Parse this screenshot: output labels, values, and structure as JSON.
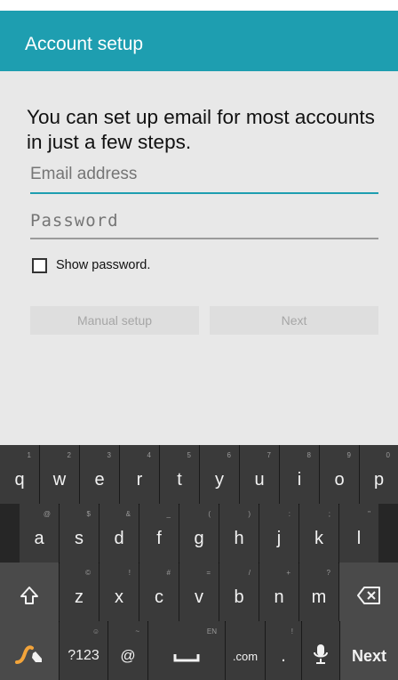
{
  "app_bar": {
    "title": "Account setup"
  },
  "form": {
    "intro": "You can set up email for most accounts in just a few steps.",
    "email_placeholder": "Email address",
    "password_placeholder": "Password",
    "show_password_label": "Show password.",
    "manual_setup_label": "Manual setup",
    "next_label": "Next"
  },
  "keyboard": {
    "row1": [
      {
        "label": "q",
        "hint": "1"
      },
      {
        "label": "w",
        "hint": "2"
      },
      {
        "label": "e",
        "hint": "3"
      },
      {
        "label": "r",
        "hint": "4"
      },
      {
        "label": "t",
        "hint": "5"
      },
      {
        "label": "y",
        "hint": "6"
      },
      {
        "label": "u",
        "hint": "7"
      },
      {
        "label": "i",
        "hint": "8"
      },
      {
        "label": "o",
        "hint": "9"
      },
      {
        "label": "p",
        "hint": "0"
      }
    ],
    "row2": [
      {
        "label": "a",
        "hint": "@"
      },
      {
        "label": "s",
        "hint": "$"
      },
      {
        "label": "d",
        "hint": "&"
      },
      {
        "label": "f",
        "hint": "_"
      },
      {
        "label": "g",
        "hint": "("
      },
      {
        "label": "h",
        "hint": ")"
      },
      {
        "label": "j",
        "hint": ":"
      },
      {
        "label": "k",
        "hint": ";"
      },
      {
        "label": "l",
        "hint": "\""
      }
    ],
    "row3": {
      "letters": [
        {
          "label": "z",
          "hint": "©"
        },
        {
          "label": "x",
          "hint": "!"
        },
        {
          "label": "c",
          "hint": "#"
        },
        {
          "label": "v",
          "hint": "="
        },
        {
          "label": "b",
          "hint": "/"
        },
        {
          "label": "n",
          "hint": "+"
        },
        {
          "label": "m",
          "hint": "?"
        }
      ]
    },
    "row4": {
      "symbols_label": "?123",
      "symbols_hint": "☺",
      "at_label": "@",
      "at_hint": "~",
      "space_hint": "EN",
      "dotcom_label": ".com",
      "period_label": ".",
      "period_hint": "!",
      "next_label": "Next"
    }
  }
}
